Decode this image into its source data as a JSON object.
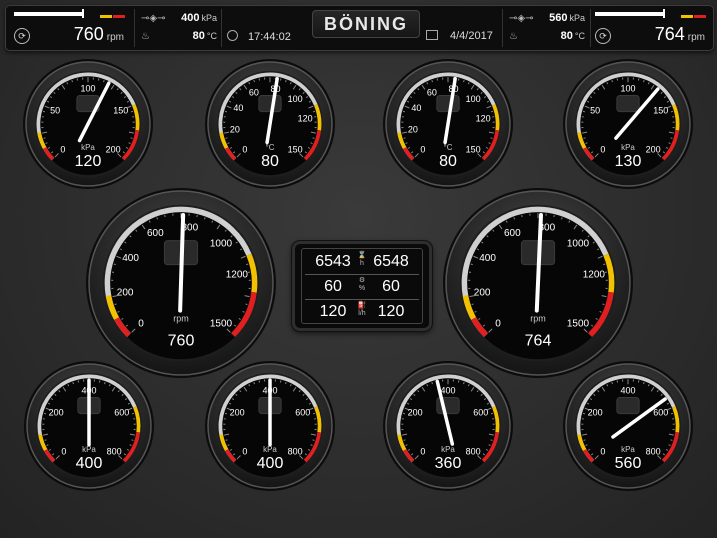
{
  "brand": "BÖNING",
  "top_bar": {
    "left_engine": {
      "rpm_value": "760",
      "rpm_unit": "rpm"
    },
    "right_engine": {
      "rpm_value": "764",
      "rpm_unit": "rpm"
    },
    "left_info": {
      "pressure_value": "400",
      "pressure_unit": "kPa",
      "temp_value": "80",
      "temp_unit": "°C"
    },
    "right_info": {
      "pressure_value": "560",
      "pressure_unit": "kPa",
      "temp_value": "80",
      "temp_unit": "°C"
    },
    "time": "17:44:02",
    "date": "4/4/2017"
  },
  "gauges": {
    "row1": [
      {
        "id": "g1",
        "ticks": [
          "0",
          "50",
          "100",
          "150",
          "200"
        ],
        "unit": "kPa",
        "value_text": "120",
        "min": 0,
        "max": 200,
        "value": 120
      },
      {
        "id": "g2",
        "ticks": [
          "0",
          "20",
          "40",
          "60",
          "80",
          "100",
          "120",
          "150"
        ],
        "unit": "°C",
        "value_text": "80",
        "min": 0,
        "max": 150,
        "value": 80
      },
      {
        "id": "g3",
        "ticks": [
          "0",
          "20",
          "40",
          "60",
          "80",
          "100",
          "120",
          "150"
        ],
        "unit": "°C",
        "value_text": "80",
        "min": 0,
        "max": 150,
        "value": 80
      },
      {
        "id": "g4",
        "ticks": [
          "0",
          "50",
          "100",
          "150",
          "200"
        ],
        "unit": "kPa",
        "value_text": "130",
        "min": 0,
        "max": 200,
        "value": 130
      }
    ],
    "rpm": [
      {
        "id": "rpm-left",
        "ticks": [
          "0",
          "200",
          "400",
          "600",
          "800",
          "1000",
          "1200",
          "1500"
        ],
        "unit": "rpm",
        "value_text": "760",
        "min": 0,
        "max": 1500,
        "value": 760
      },
      {
        "id": "rpm-right",
        "ticks": [
          "0",
          "200",
          "400",
          "600",
          "800",
          "1000",
          "1200",
          "1500"
        ],
        "unit": "rpm",
        "value_text": "764",
        "min": 0,
        "max": 1500,
        "value": 764
      }
    ],
    "row3": [
      {
        "id": "g5",
        "ticks": [
          "0",
          "200",
          "400",
          "600",
          "800"
        ],
        "unit": "kPa",
        "value_text": "400",
        "min": 0,
        "max": 800,
        "value": 400
      },
      {
        "id": "g6",
        "ticks": [
          "0",
          "200",
          "400",
          "600",
          "800"
        ],
        "unit": "kPa",
        "value_text": "400",
        "min": 0,
        "max": 800,
        "value": 400
      },
      {
        "id": "g7",
        "ticks": [
          "0",
          "200",
          "400",
          "600",
          "800"
        ],
        "unit": "kPa",
        "value_text": "360",
        "min": 0,
        "max": 800,
        "value": 360
      },
      {
        "id": "g8",
        "ticks": [
          "0",
          "200",
          "400",
          "600",
          "800"
        ],
        "unit": "kPa",
        "value_text": "560",
        "min": 0,
        "max": 800,
        "value": 560
      }
    ]
  },
  "center_panel": {
    "hours": {
      "left": "6543",
      "right": "6548",
      "unit": "h"
    },
    "load": {
      "left": "60",
      "right": "60",
      "unit": "%"
    },
    "fuel": {
      "left": "120",
      "right": "120",
      "unit": "l/h"
    }
  },
  "colors": {
    "warn_yellow": "#f2c200",
    "alarm_red": "#e02020",
    "needle": "#ffffff"
  }
}
